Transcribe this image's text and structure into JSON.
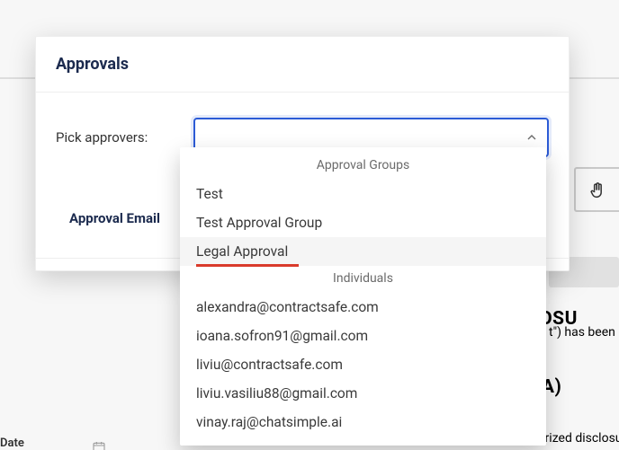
{
  "modal": {
    "title": "Approvals",
    "field_label": "Pick approvers:",
    "email_label": "Approval Email"
  },
  "dropdown": {
    "group_header": "Approval Groups",
    "individual_header": "Individuals",
    "groups": [
      {
        "label": "Test"
      },
      {
        "label": "Test Approval Group"
      },
      {
        "label": "Legal Approval",
        "hover": true,
        "accent": true
      }
    ],
    "individuals": [
      {
        "label": "alexandra@contractsafe.com"
      },
      {
        "label": "ioana.sofron91@gmail.com"
      },
      {
        "label": "liviu@contractsafe.com"
      },
      {
        "label": "liviu.vasiliu88@gmail.com"
      },
      {
        "label": "vinay.raj@chatsimple.ai"
      }
    ]
  },
  "background": {
    "date_label": "Date",
    "doc_title_line1": "LOSU",
    "doc_title_line2": "DA)",
    "doc_snip1": "t\") has been",
    "doc_snip2": "For the purpose of preventing the unauthorized disclosure"
  }
}
